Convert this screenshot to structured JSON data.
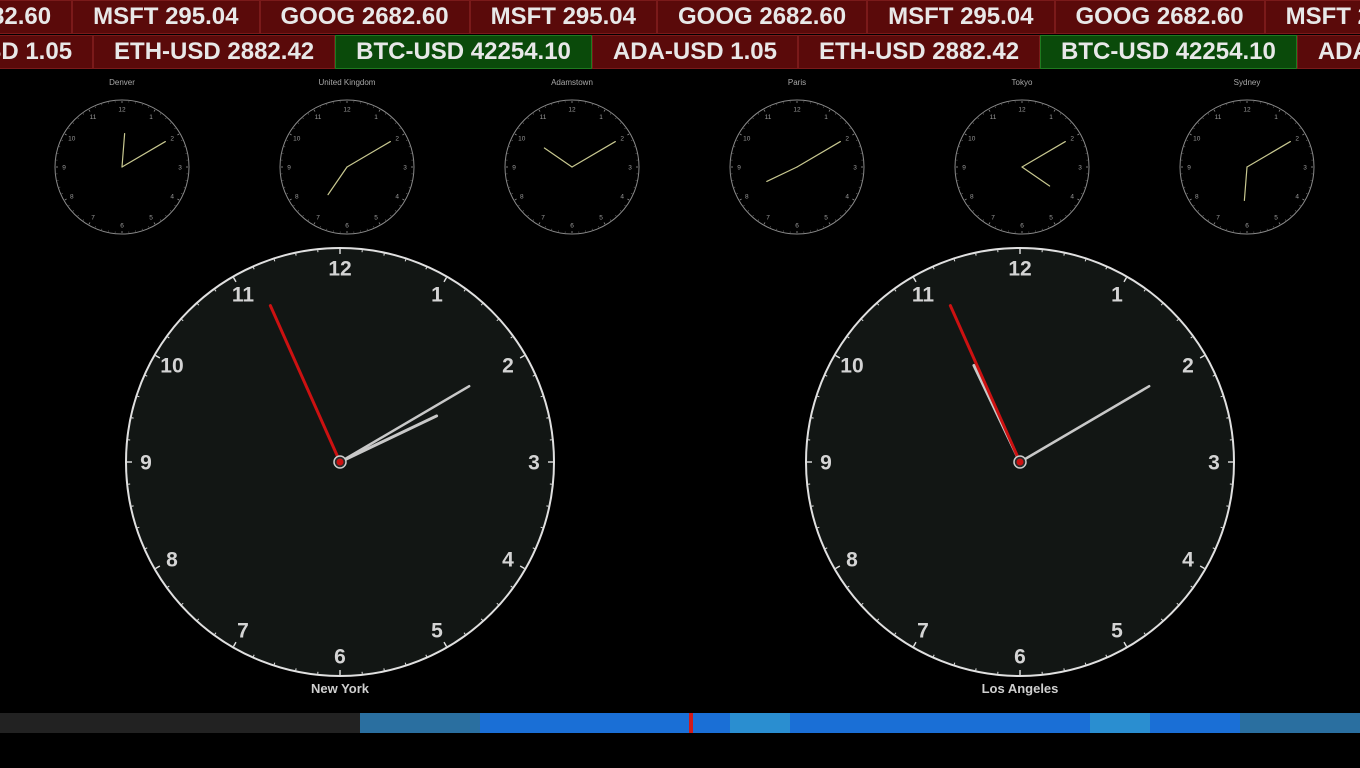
{
  "tickers": {
    "stocks": [
      {
        "symbol": "GOOG",
        "price": "2682.60",
        "trend": "down"
      },
      {
        "symbol": "MSFT",
        "price": "295.04",
        "trend": "down"
      }
    ],
    "crypto": [
      {
        "symbol": "ADA-USD",
        "price": "1.05",
        "trend": "down"
      },
      {
        "symbol": "ETH-USD",
        "price": "2882.42",
        "trend": "down"
      },
      {
        "symbol": "BTC-USD",
        "price": "42254.10",
        "trend": "up"
      }
    ]
  },
  "world_clocks": [
    {
      "city": "Denver",
      "time": "12:09:56"
    },
    {
      "city": "United Kingdom",
      "time": "19:09:56"
    },
    {
      "city": "Adamstown",
      "time": "10:09:56"
    },
    {
      "city": "Paris",
      "time": "20:09:56"
    },
    {
      "city": "Tokyo",
      "time": "04:09:56"
    },
    {
      "city": "Sydney",
      "time": "06:09:56"
    }
  ],
  "main_clocks": [
    {
      "city": "New York",
      "time": "14:09:56"
    },
    {
      "city": "Los Angeles",
      "time": "11:09:56"
    }
  ],
  "colors": {
    "stock_down_bg": "#5a0a0a",
    "stock_up_bg": "#0a4a0a",
    "clock_face": "#121614",
    "small_hand": "#c8c890",
    "big_hand": "#c8c8c8",
    "second_hand": "#cc1111"
  },
  "timeline": {
    "segments": [
      {
        "color": "#222222",
        "fraction": 0.2647
      },
      {
        "color": "#2a6fa0",
        "fraction": 0.0882
      },
      {
        "color": "#1a6fd6",
        "fraction": 0.1544
      },
      {
        "color": "#1a6fd6",
        "fraction": 0.0294
      },
      {
        "color": "#2a8ed0",
        "fraction": 0.0441
      },
      {
        "color": "#1a6fd6",
        "fraction": 0.2206
      },
      {
        "color": "#2a8ed0",
        "fraction": 0.0441
      },
      {
        "color": "#1a6fd6",
        "fraction": 0.0662
      },
      {
        "color": "#2a6fa0",
        "fraction": 0.0956
      }
    ],
    "marker_fraction": 0.5066,
    "marker_color": "#d11a1a"
  }
}
